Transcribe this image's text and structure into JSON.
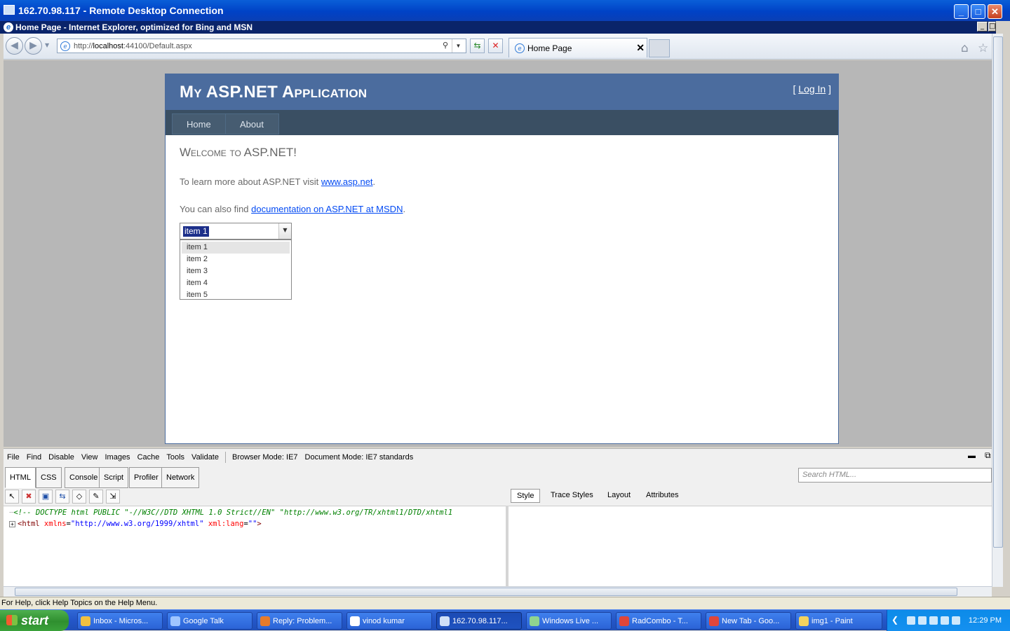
{
  "rdp": {
    "title": "162.70.98.117 - Remote Desktop Connection"
  },
  "ie": {
    "title": "Home Page - Internet Explorer, optimized for Bing and MSN",
    "address": {
      "prefix": "http://",
      "host": "localhost",
      "rest": ":44100/Default.aspx"
    },
    "tab_label": "Home Page"
  },
  "page": {
    "app_title": "My ASP.NET Application",
    "login_open": "[ ",
    "login_link": "Log In",
    "login_close": " ]",
    "menu": [
      "Home",
      "About"
    ],
    "welcome": "Welcome to ASP.NET!",
    "para1_text": "To learn more about ASP.NET visit ",
    "para1_link": "www.asp.net",
    "para1_end": ".",
    "para2_text": "You can also find ",
    "para2_link": "documentation on ASP.NET at MSDN",
    "para2_end": ".",
    "combo": {
      "value": "item 1",
      "items": [
        "item 1",
        "item 2",
        "item 3",
        "item 4",
        "item 5"
      ]
    }
  },
  "devtools": {
    "menu": [
      "File",
      "Find",
      "Disable",
      "View",
      "Images",
      "Cache",
      "Tools",
      "Validate"
    ],
    "browser_mode": "Browser Mode: IE7",
    "document_mode": "Document Mode: IE7 standards",
    "tabs": [
      "HTML",
      "CSS",
      "Console",
      "Script",
      "Profiler",
      "Network"
    ],
    "search_placeholder": "Search HTML...",
    "right_tabs": [
      "Style",
      "Trace Styles",
      "Layout",
      "Attributes"
    ],
    "tree": {
      "doctype": "<!-- DOCTYPE html PUBLIC \"-//W3C//DTD XHTML 1.0 Strict//EN\" \"http://www.w3.org/TR/xhtml1/DTD/xhtml1",
      "html_open": "<html",
      "attr1_name": " xmlns",
      "attr1_eq": "=",
      "attr1_value": "\"http://www.w3.org/1999/xhtml\"",
      "attr2_name": " xml:lang",
      "attr2_eq": "=",
      "attr2_value": "\"\"",
      "html_close": ">"
    }
  },
  "statusbar": {
    "text": "For Help, click Help Topics on the Help Menu."
  },
  "taskbar": {
    "start_label": "start",
    "tasks": [
      "Inbox - Micros...",
      "Google Talk",
      "Reply: Problem...",
      "vinod kumar",
      "162.70.98.117...",
      "Windows Live ...",
      "RadCombo - T...",
      "New Tab - Goo...",
      "img1 - Paint"
    ],
    "clock": "12:29 PM"
  }
}
